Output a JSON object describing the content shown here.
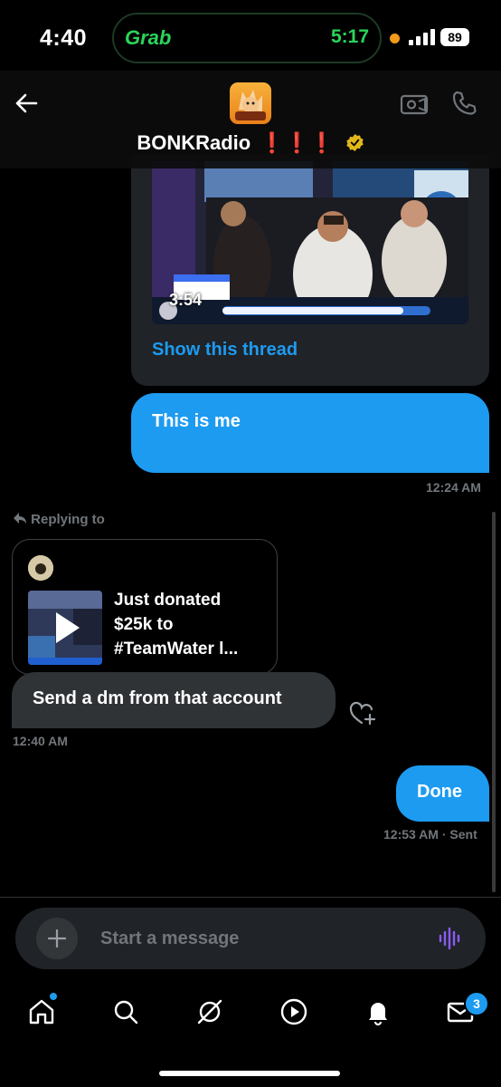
{
  "status_bar": {
    "time": "4:40",
    "live_activity_app": "Grab",
    "live_activity_time": "5:17",
    "battery": "89"
  },
  "header": {
    "name": "BONKRadio",
    "emoji": "❗❗❗",
    "logo_text": "RADIO"
  },
  "thread_card": {
    "video_duration": "3:54",
    "show_thread_label": "Show this thread"
  },
  "messages": [
    {
      "id": "m1",
      "text": "This is me",
      "time": "12:24 AM",
      "sender": "me"
    },
    {
      "id": "m2",
      "text": "Send a dm from that account",
      "time": "12:40 AM",
      "sender": "other"
    },
    {
      "id": "m3",
      "text": "Done",
      "time": "12:53 AM",
      "status": "· Sent",
      "sender": "me"
    }
  ],
  "reply_context": {
    "label": "Replying to",
    "lines": [
      "Just donated",
      "$25k to",
      "#TeamWater l..."
    ]
  },
  "composer": {
    "placeholder": "Start a message"
  },
  "nav": {
    "messages_badge": "3"
  },
  "colors": {
    "accent": "#1d9bf0",
    "background": "#000000",
    "bubble_other": "#2f3336",
    "error_red": "#e0231d",
    "grab_green": "#2bd45a"
  },
  "icons": [
    "back-arrow-icon",
    "video-call-icon",
    "phone-icon",
    "verified-badge-icon",
    "heart-add-icon",
    "plus-icon",
    "voice-wave-icon",
    "home-icon",
    "search-icon",
    "grok-icon",
    "video-icon",
    "bell-icon",
    "mail-icon"
  ]
}
